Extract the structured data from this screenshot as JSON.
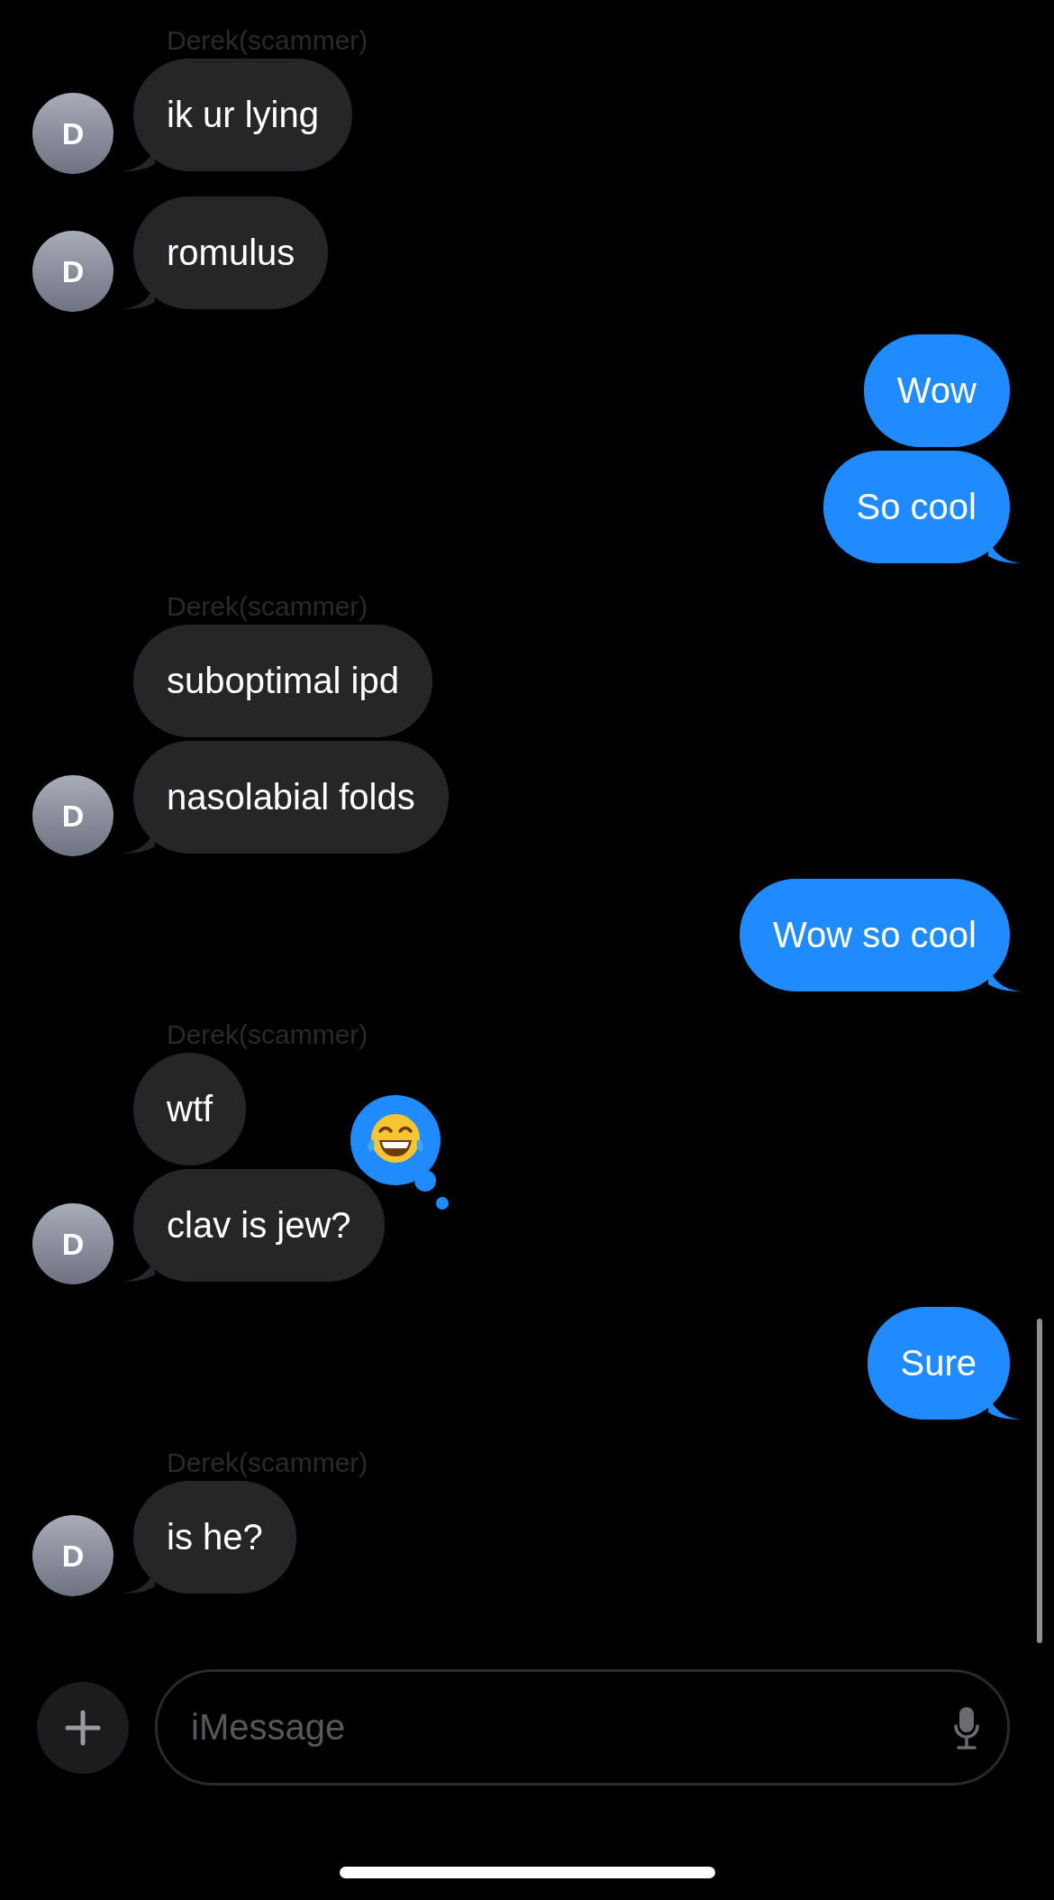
{
  "conversation": [
    {
      "kind": "incoming",
      "name": "Derek(scammer)",
      "avatar": "D",
      "bubbles": [
        {
          "text": "ik ur lying"
        }
      ]
    },
    {
      "kind": "incoming",
      "avatar": "D",
      "bubbles": [
        {
          "text": "romulus"
        }
      ]
    },
    {
      "kind": "outgoing",
      "bubbles": [
        {
          "text": "Wow"
        },
        {
          "text": "So cool"
        }
      ]
    },
    {
      "kind": "incoming",
      "name": "Derek(scammer)",
      "avatar": "D",
      "bubbles": [
        {
          "text": "suboptimal ipd"
        },
        {
          "text": "nasolabial folds"
        }
      ]
    },
    {
      "kind": "outgoing",
      "bubbles": [
        {
          "text": "Wow so cool"
        }
      ]
    },
    {
      "kind": "incoming",
      "name": "Derek(scammer)",
      "avatar": "D",
      "bubbles": [
        {
          "text": "wtf"
        },
        {
          "text": "clav is jew?",
          "reaction": {
            "kind": "laugh"
          }
        }
      ]
    },
    {
      "kind": "outgoing",
      "bubbles": [
        {
          "text": "Sure"
        }
      ]
    },
    {
      "kind": "incoming",
      "name": "Derek(scammer)",
      "avatar": "D",
      "bubbles": [
        {
          "text": "is he?"
        }
      ]
    }
  ],
  "composer": {
    "placeholder": "iMessage"
  }
}
